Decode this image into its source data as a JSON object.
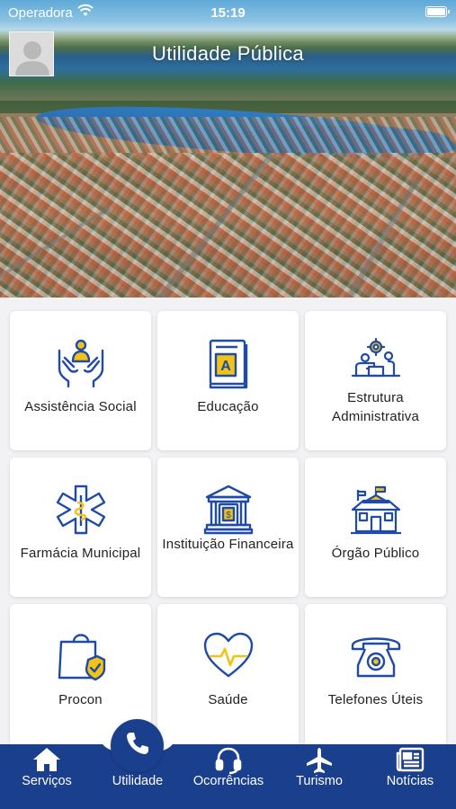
{
  "status_bar": {
    "carrier": "Operadora",
    "time": "15:19"
  },
  "header": {
    "title": "Utilidade Pública"
  },
  "services": [
    {
      "label": "Assistência Social",
      "icon": "hands-care-icon"
    },
    {
      "label": "Educação",
      "icon": "book-icon"
    },
    {
      "label": "Estrutura Administrativa",
      "icon": "admin-structure-icon"
    },
    {
      "label": "Farmácia Municipal",
      "icon": "pharmacy-icon"
    },
    {
      "label": "Instituição Financeira",
      "icon": "bank-icon"
    },
    {
      "label": "Órgão Público",
      "icon": "public-building-icon"
    },
    {
      "label": "Procon",
      "icon": "shopping-bag-shield-icon"
    },
    {
      "label": "Saúde",
      "icon": "heart-pulse-icon"
    },
    {
      "label": "Telefones Úteis",
      "icon": "telephone-icon"
    }
  ],
  "bottom_nav": [
    {
      "label": "Serviços",
      "icon": "home-icon"
    },
    {
      "label": "Utilidade",
      "icon": "phone-icon",
      "active": true
    },
    {
      "label": "Ocorrências",
      "icon": "headset-icon"
    },
    {
      "label": "Turismo",
      "icon": "airplane-icon"
    },
    {
      "label": "Notícias",
      "icon": "newspaper-icon"
    }
  ],
  "colors": {
    "accent": "#1a3f8c",
    "icon_blue": "#1f4aa8",
    "icon_yellow": "#f2c316"
  }
}
